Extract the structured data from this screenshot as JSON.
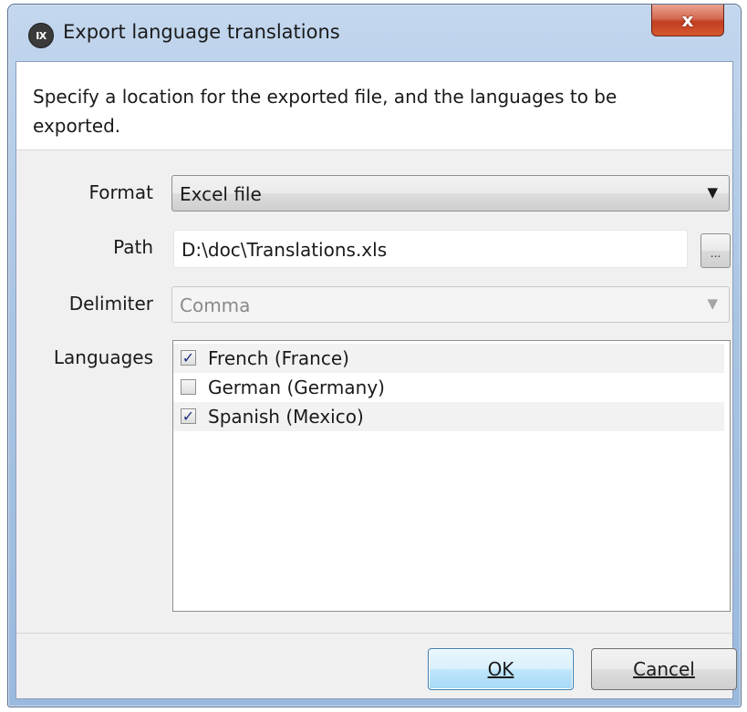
{
  "window": {
    "app_icon_text": "IX",
    "title": "Export language translations",
    "close_glyph": "x"
  },
  "header": {
    "instructions": "Specify a location for the exported file, and the languages to be exported."
  },
  "form": {
    "format": {
      "label": "Format",
      "value": "Excel file",
      "arrow_icon": "dropdown-arrow"
    },
    "path": {
      "label": "Path",
      "value": "D:\\doc\\Translations.xls",
      "browse_label": "..."
    },
    "delimiter": {
      "label": "Delimiter",
      "value": "Comma",
      "enabled": false
    },
    "languages": {
      "label": "Languages",
      "items": [
        {
          "label": "French (France)",
          "checked": true
        },
        {
          "label": "German (Germany)",
          "checked": false
        },
        {
          "label": "Spanish (Mexico)",
          "checked": true
        }
      ]
    }
  },
  "buttons": {
    "ok": "OK",
    "cancel": "Cancel"
  },
  "colors": {
    "titlebar": "#a9c4e3",
    "close_button": "#c23e22",
    "ok_border": "#3c7fb1",
    "check_mark": "#1d2f7c"
  }
}
